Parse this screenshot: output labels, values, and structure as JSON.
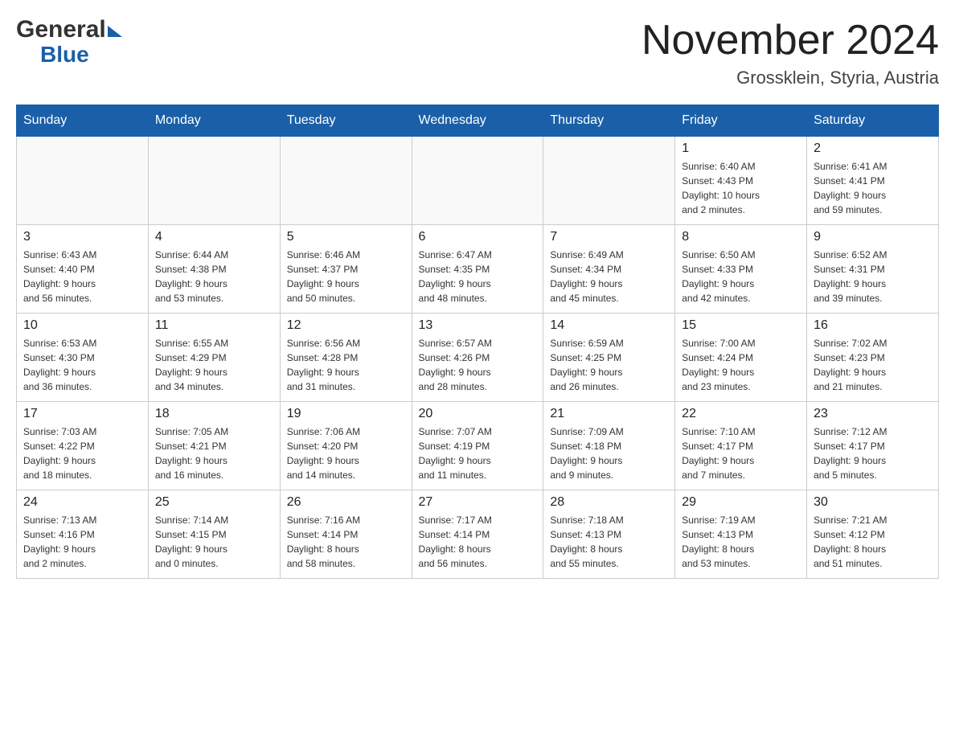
{
  "header": {
    "logo_general": "General",
    "logo_blue": "Blue",
    "month_year": "November 2024",
    "location": "Grossklein, Styria, Austria"
  },
  "days_of_week": [
    "Sunday",
    "Monday",
    "Tuesday",
    "Wednesday",
    "Thursday",
    "Friday",
    "Saturday"
  ],
  "weeks": [
    [
      {
        "day": "",
        "info": ""
      },
      {
        "day": "",
        "info": ""
      },
      {
        "day": "",
        "info": ""
      },
      {
        "day": "",
        "info": ""
      },
      {
        "day": "",
        "info": ""
      },
      {
        "day": "1",
        "info": "Sunrise: 6:40 AM\nSunset: 4:43 PM\nDaylight: 10 hours\nand 2 minutes."
      },
      {
        "day": "2",
        "info": "Sunrise: 6:41 AM\nSunset: 4:41 PM\nDaylight: 9 hours\nand 59 minutes."
      }
    ],
    [
      {
        "day": "3",
        "info": "Sunrise: 6:43 AM\nSunset: 4:40 PM\nDaylight: 9 hours\nand 56 minutes."
      },
      {
        "day": "4",
        "info": "Sunrise: 6:44 AM\nSunset: 4:38 PM\nDaylight: 9 hours\nand 53 minutes."
      },
      {
        "day": "5",
        "info": "Sunrise: 6:46 AM\nSunset: 4:37 PM\nDaylight: 9 hours\nand 50 minutes."
      },
      {
        "day": "6",
        "info": "Sunrise: 6:47 AM\nSunset: 4:35 PM\nDaylight: 9 hours\nand 48 minutes."
      },
      {
        "day": "7",
        "info": "Sunrise: 6:49 AM\nSunset: 4:34 PM\nDaylight: 9 hours\nand 45 minutes."
      },
      {
        "day": "8",
        "info": "Sunrise: 6:50 AM\nSunset: 4:33 PM\nDaylight: 9 hours\nand 42 minutes."
      },
      {
        "day": "9",
        "info": "Sunrise: 6:52 AM\nSunset: 4:31 PM\nDaylight: 9 hours\nand 39 minutes."
      }
    ],
    [
      {
        "day": "10",
        "info": "Sunrise: 6:53 AM\nSunset: 4:30 PM\nDaylight: 9 hours\nand 36 minutes."
      },
      {
        "day": "11",
        "info": "Sunrise: 6:55 AM\nSunset: 4:29 PM\nDaylight: 9 hours\nand 34 minutes."
      },
      {
        "day": "12",
        "info": "Sunrise: 6:56 AM\nSunset: 4:28 PM\nDaylight: 9 hours\nand 31 minutes."
      },
      {
        "day": "13",
        "info": "Sunrise: 6:57 AM\nSunset: 4:26 PM\nDaylight: 9 hours\nand 28 minutes."
      },
      {
        "day": "14",
        "info": "Sunrise: 6:59 AM\nSunset: 4:25 PM\nDaylight: 9 hours\nand 26 minutes."
      },
      {
        "day": "15",
        "info": "Sunrise: 7:00 AM\nSunset: 4:24 PM\nDaylight: 9 hours\nand 23 minutes."
      },
      {
        "day": "16",
        "info": "Sunrise: 7:02 AM\nSunset: 4:23 PM\nDaylight: 9 hours\nand 21 minutes."
      }
    ],
    [
      {
        "day": "17",
        "info": "Sunrise: 7:03 AM\nSunset: 4:22 PM\nDaylight: 9 hours\nand 18 minutes."
      },
      {
        "day": "18",
        "info": "Sunrise: 7:05 AM\nSunset: 4:21 PM\nDaylight: 9 hours\nand 16 minutes."
      },
      {
        "day": "19",
        "info": "Sunrise: 7:06 AM\nSunset: 4:20 PM\nDaylight: 9 hours\nand 14 minutes."
      },
      {
        "day": "20",
        "info": "Sunrise: 7:07 AM\nSunset: 4:19 PM\nDaylight: 9 hours\nand 11 minutes."
      },
      {
        "day": "21",
        "info": "Sunrise: 7:09 AM\nSunset: 4:18 PM\nDaylight: 9 hours\nand 9 minutes."
      },
      {
        "day": "22",
        "info": "Sunrise: 7:10 AM\nSunset: 4:17 PM\nDaylight: 9 hours\nand 7 minutes."
      },
      {
        "day": "23",
        "info": "Sunrise: 7:12 AM\nSunset: 4:17 PM\nDaylight: 9 hours\nand 5 minutes."
      }
    ],
    [
      {
        "day": "24",
        "info": "Sunrise: 7:13 AM\nSunset: 4:16 PM\nDaylight: 9 hours\nand 2 minutes."
      },
      {
        "day": "25",
        "info": "Sunrise: 7:14 AM\nSunset: 4:15 PM\nDaylight: 9 hours\nand 0 minutes."
      },
      {
        "day": "26",
        "info": "Sunrise: 7:16 AM\nSunset: 4:14 PM\nDaylight: 8 hours\nand 58 minutes."
      },
      {
        "day": "27",
        "info": "Sunrise: 7:17 AM\nSunset: 4:14 PM\nDaylight: 8 hours\nand 56 minutes."
      },
      {
        "day": "28",
        "info": "Sunrise: 7:18 AM\nSunset: 4:13 PM\nDaylight: 8 hours\nand 55 minutes."
      },
      {
        "day": "29",
        "info": "Sunrise: 7:19 AM\nSunset: 4:13 PM\nDaylight: 8 hours\nand 53 minutes."
      },
      {
        "day": "30",
        "info": "Sunrise: 7:21 AM\nSunset: 4:12 PM\nDaylight: 8 hours\nand 51 minutes."
      }
    ]
  ]
}
